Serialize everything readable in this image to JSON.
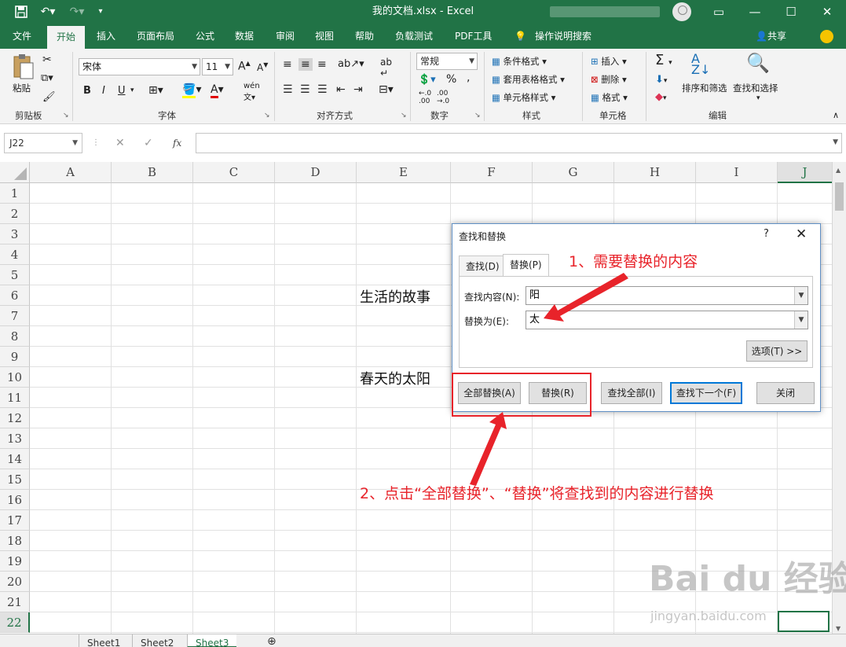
{
  "titlebar": {
    "title": "我的文档.xlsx  -  Excel",
    "quick_access": [
      "save-icon",
      "undo-icon",
      "redo-icon",
      "customize-icon"
    ]
  },
  "menu": {
    "tabs": [
      "文件",
      "开始",
      "插入",
      "页面布局",
      "公式",
      "数据",
      "审阅",
      "视图",
      "帮助",
      "负载测试",
      "PDF工具",
      "操作说明搜索"
    ],
    "active_tab": "开始",
    "share": "共享"
  },
  "ribbon": {
    "clipboard": {
      "paste": "粘贴",
      "label": "剪贴板"
    },
    "font": {
      "name": "宋体",
      "size": "11",
      "bold": "B",
      "italic": "I",
      "underline": "U",
      "label": "字体"
    },
    "alignment": {
      "label": "对齐方式"
    },
    "number": {
      "format": "常规",
      "percent": "%",
      "comma": ",",
      "label": "数字"
    },
    "styles": {
      "conditional": "条件格式",
      "table": "套用表格格式",
      "cell": "单元格样式",
      "label": "样式"
    },
    "cells": {
      "insert": "插入",
      "delete": "删除",
      "format": "格式",
      "label": "单元格"
    },
    "editing": {
      "sort": "排序和筛选",
      "find": "查找和选择",
      "label": "编辑"
    }
  },
  "formula_bar": {
    "name_box": "J22",
    "fx": "fx",
    "value": ""
  },
  "grid": {
    "columns": [
      "A",
      "B",
      "C",
      "D",
      "E",
      "F",
      "G",
      "H",
      "I",
      "J"
    ],
    "rows": [
      "1",
      "2",
      "3",
      "4",
      "5",
      "6",
      "7",
      "8",
      "9",
      "10",
      "11",
      "12",
      "13",
      "14",
      "15",
      "16",
      "17",
      "18",
      "19",
      "20",
      "21",
      "22"
    ],
    "active_cell": "J22",
    "cells": {
      "E6": "生活的故事",
      "E10": "春天的太阳"
    }
  },
  "sheets": [
    "Sheet1",
    "Sheet2",
    "Sheet3"
  ],
  "active_sheet": "Sheet3",
  "dialog": {
    "title": "查找和替换",
    "help": "?",
    "close": "✕",
    "tabs": [
      "查找(D)",
      "替换(P)"
    ],
    "active_tab": "替换(P)",
    "find_label": "查找内容(N):",
    "find_value": "阳",
    "replace_label": "替换为(E):",
    "replace_value": "太",
    "options_button": "选项(T) >>",
    "buttons": {
      "replace_all": "全部替换(A)",
      "replace": "替换(R)",
      "find_all": "查找全部(I)",
      "find_next": "查找下一个(F)",
      "close": "关闭"
    }
  },
  "annotations": {
    "step1": "1、需要替换的内容",
    "step2": "2、点击“全部替换”、“替换”将查找到的内容进行替换",
    "color": "#e8232a"
  },
  "watermark": {
    "brand": "Bai du 经验",
    "url": "jingyan.baidu.com"
  }
}
